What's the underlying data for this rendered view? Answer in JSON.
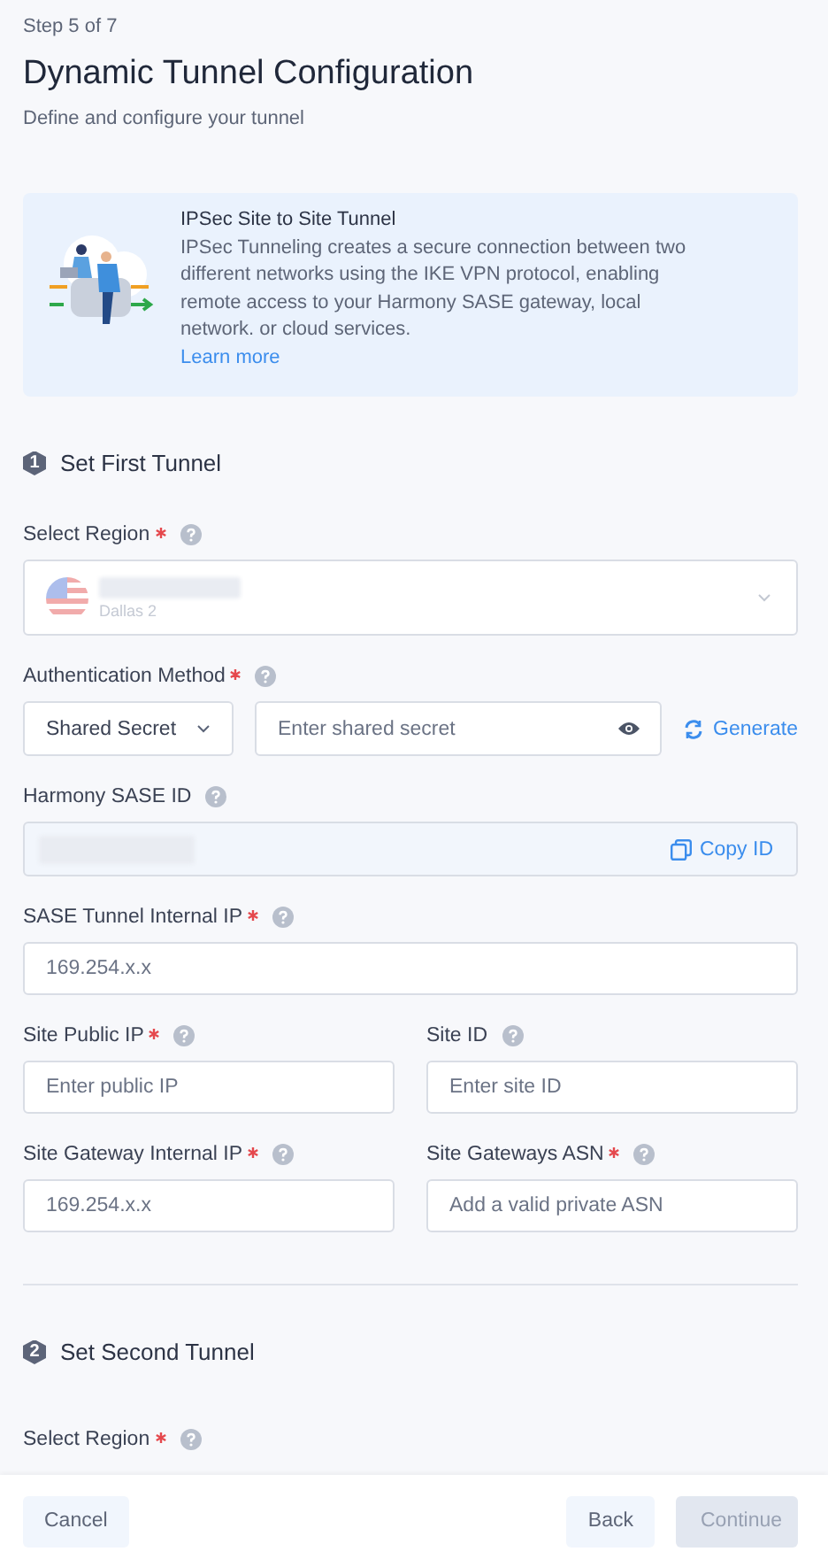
{
  "step": "Step 5 of 7",
  "title": "Dynamic Tunnel Configuration",
  "subtitle": "Define and configure your tunnel",
  "info": {
    "title": "IPSec Site to Site Tunnel",
    "body": "IPSec Tunneling creates a secure connection between two different networks using the IKE VPN protocol, enabling remote access to your Harmony SASE gateway, local network. or cloud services.",
    "link": "Learn more"
  },
  "tunnels": [
    {
      "number": "1",
      "title": "Set First Tunnel",
      "fields": [
        {
          "kind": "region",
          "label": "Select Region",
          "required": true,
          "value": "Dallas 2"
        },
        {
          "kind": "auth",
          "label": "Authentication Method",
          "required": true,
          "method": "Shared Secret",
          "placeholder": "Enter shared secret",
          "action": "Generate"
        },
        {
          "kind": "readonly",
          "label": "Harmony SASE ID",
          "required": false,
          "action": "Copy ID"
        },
        {
          "kind": "text",
          "label": "SASE Tunnel Internal IP",
          "required": true,
          "placeholder": "169.254.x.x"
        },
        {
          "kind": "half",
          "label": "Site Public IP",
          "required": true,
          "placeholder": "Enter public IP"
        },
        {
          "kind": "half",
          "label": "Site ID",
          "required": false,
          "placeholder": "Enter site ID"
        },
        {
          "kind": "half",
          "label": "Site Gateway Internal IP",
          "required": true,
          "placeholder": "169.254.x.x"
        },
        {
          "kind": "half",
          "label": "Site Gateways ASN",
          "required": true,
          "placeholder": "Add a valid private ASN"
        }
      ]
    },
    {
      "number": "2",
      "title": "Set Second Tunnel",
      "fields": [
        {
          "kind": "label_only",
          "label": "Select Region",
          "required": true
        }
      ]
    }
  ],
  "footer": [
    {
      "label": "Cancel",
      "kind": "cancel",
      "disabled": false
    },
    {
      "label": "Back",
      "kind": "back",
      "disabled": false
    },
    {
      "label": "Continue",
      "kind": "primary",
      "disabled": true
    }
  ]
}
